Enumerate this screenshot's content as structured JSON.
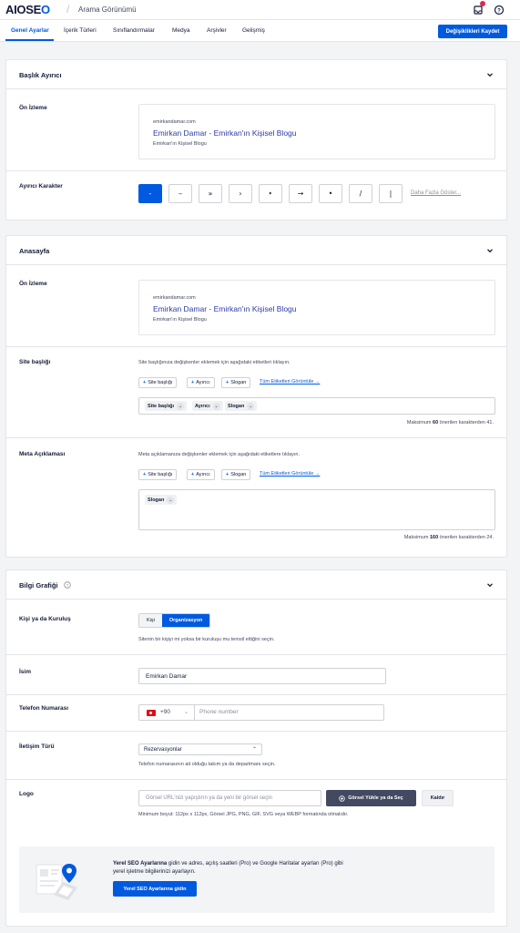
{
  "header": {
    "logo_main": "AIOSE",
    "logo_o": "O",
    "breadcrumb": "Arama Görünümü",
    "icons": [
      "notifications-icon",
      "help-icon"
    ]
  },
  "tabs": [
    {
      "label": "Genel Ayarlar",
      "active": true
    },
    {
      "label": "İçerik Türleri"
    },
    {
      "label": "Sınıflandırmalar"
    },
    {
      "label": "Medya"
    },
    {
      "label": "Arşivler"
    },
    {
      "label": "Gelişmiş"
    }
  ],
  "save_button": "Değişiklikleri Kaydet",
  "preview": {
    "url": "emirkandamar.com",
    "title": "Emirkan Damar - Emirkan'ın Kişisel Blogu",
    "description": "Emirkan'ın Kişisel Blogu"
  },
  "title_separator": {
    "title": "Başlık Ayırıcı",
    "preview_label": "Ön İzleme",
    "separator_label": "Ayırıcı Karakter",
    "separators": [
      "-",
      "–",
      "»",
      "›",
      "‣",
      "→",
      "•",
      "/",
      "|"
    ],
    "active_index": 0,
    "more_link": "Daha Fazla Göster..."
  },
  "homepage": {
    "title": "Anasayfa",
    "preview_label": "Ön İzleme",
    "site_title": {
      "label": "Site başlığı",
      "helper": "Site başlığınıza değişkenler eklemek için aşağıdaki etiketleri tıklayın.",
      "tags": [
        "Site başlığı",
        "Ayırıcı",
        "Slogan"
      ],
      "tags_link": "Tüm Etiketleri Görüntüle →",
      "chips": [
        "Site başlığı",
        "Ayırıcı",
        "Slogan"
      ],
      "counter_prefix": "Maksimum ",
      "counter_max": "60",
      "counter_suffix": " önerilen karakterden 41."
    },
    "meta_desc": {
      "label": "Meta Açıklaması",
      "helper": "Meta açıklamanıza değişkenler eklemek için aşağıdaki etiketlere tıklayın.",
      "tags": [
        "Site başlığı",
        "Ayırıcı",
        "Slogan"
      ],
      "tags_link": "Tüm Etiketleri Görüntüle →",
      "chips": [
        "Slogan"
      ],
      "counter_prefix": "Maksimum ",
      "counter_max": "160",
      "counter_suffix": " önerilen karakterden 24."
    }
  },
  "knowledge_graph": {
    "title": "Bilgi Grafiği",
    "person_org": {
      "label": "Kişi ya da Kuruluş",
      "options": [
        "Kişi",
        "Organizasyon"
      ],
      "selected": "Organizasyon",
      "helper": "Sitenin bir kişiyi mi yoksa bir kuruluşu mu temsil ettiğini seçin."
    },
    "name": {
      "label": "İsim",
      "value": "Emirkan Damar"
    },
    "phone": {
      "label": "Telefon Numarası",
      "dial_code": "+90",
      "placeholder": "Phone number"
    },
    "contact_type": {
      "label": "İletişim Türü",
      "value": "Rezervasyonlar",
      "helper": "Telefon numarasının ait olduğu takım ya da departmanı seçin."
    },
    "logo": {
      "label": "Logo",
      "placeholder": "Görsel URL'nizi yapıştırın ya da yeni bir görsel seçin",
      "upload_button": "Görsel Yükle ya da Seç",
      "remove_button": "Kaldır",
      "helper": "Minimum boyut: 112px x 112px, Görsel JPG, PNG, GIF, SVG veya WEBP formatında olmalıdır."
    },
    "local_seo": {
      "text_bold": "Yerel SEO Ayarlarına",
      "text_rest": " gidin ve adres, açılış saatleri (Pro) ve Google Haritalar ayarları (Pro) gibi yerel işletme bilgilerinizi ayarlayın.",
      "button": "Yerel SEO Ayarlarına gidin"
    }
  },
  "colors": {
    "accent": "#005ae0",
    "text": "#141b38",
    "border": "#e4e5e9",
    "background": "#f3f4f5"
  }
}
